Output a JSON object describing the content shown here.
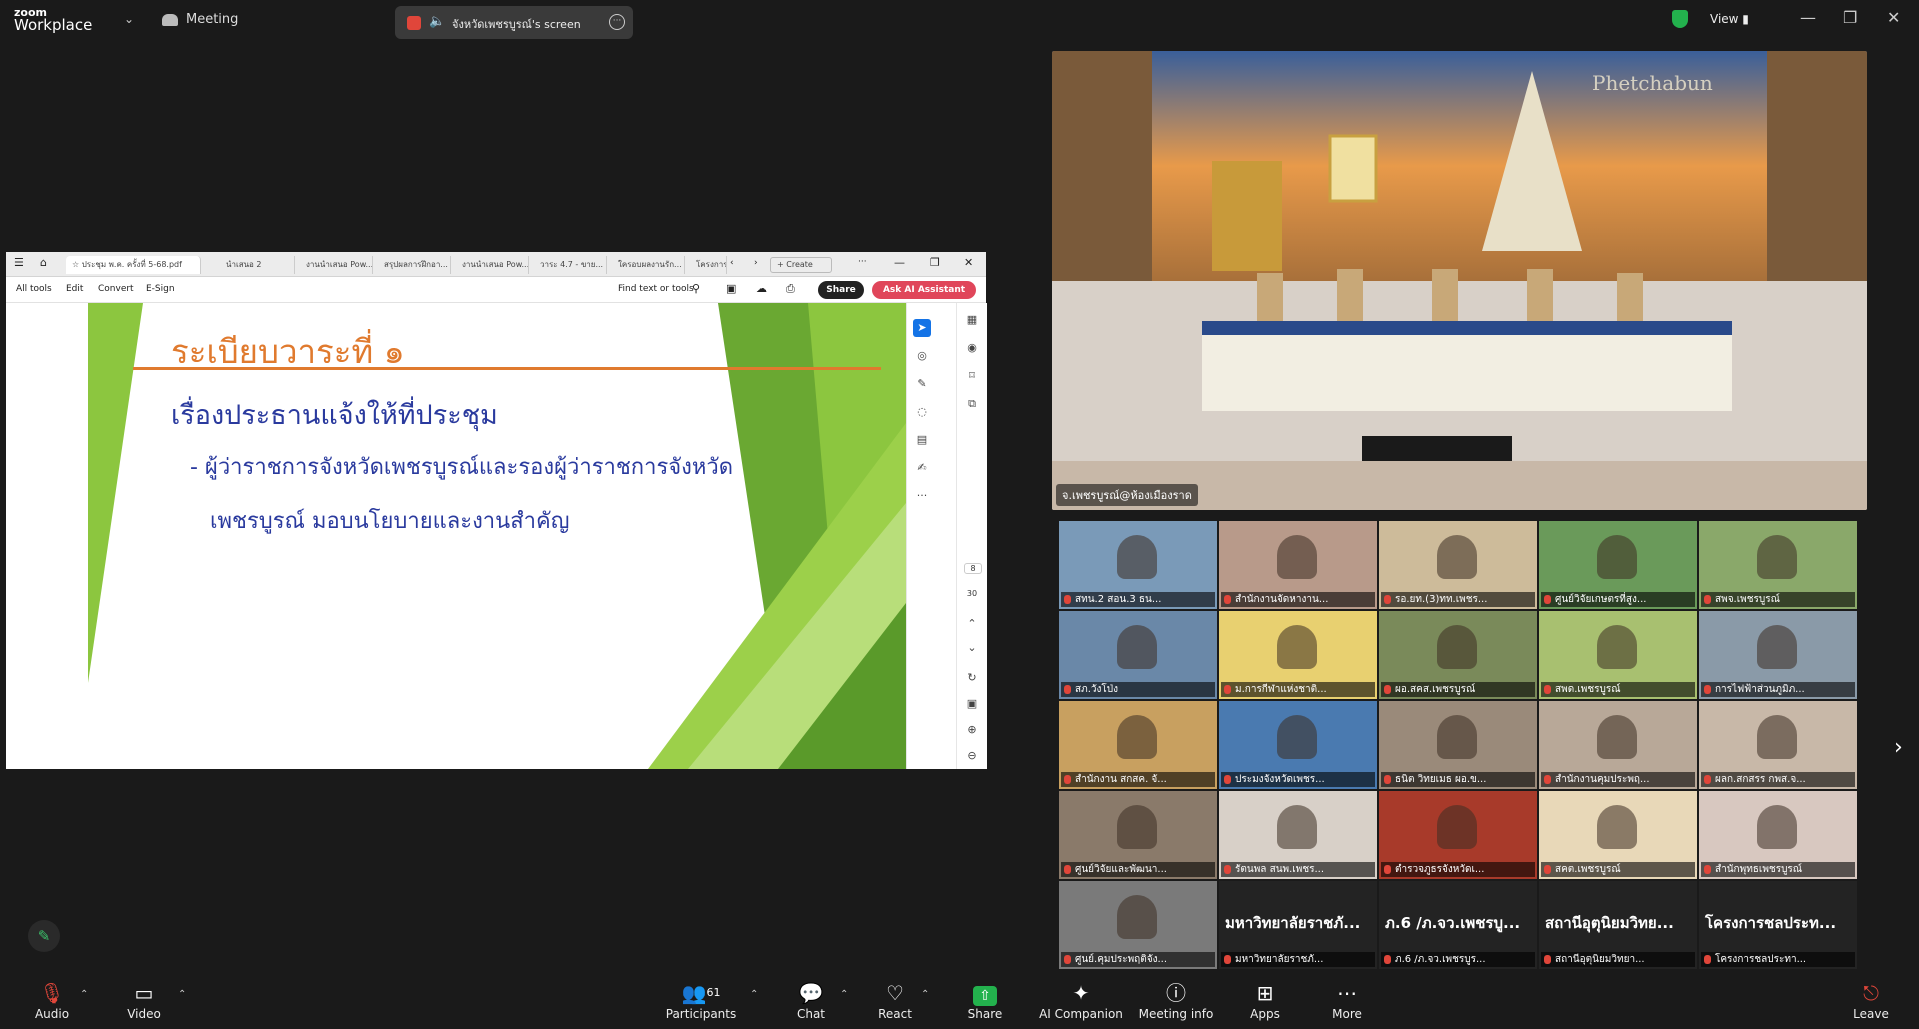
{
  "app": {
    "brand_top": "zoom",
    "brand_bottom": "Workplace",
    "meeting_label": "Meeting",
    "screen_share_label": "จังหวัดเพชรบูรณ์'s screen",
    "view_label": "View"
  },
  "pdf": {
    "tabs": [
      "ประชุม พ.ค. ครั้งที่ 5-68.pdf",
      "นำเสนอ 2",
      "งานนำเสนอ Pow...",
      "สรุปผลการฝึกอา...",
      "งานนำเสนอ Pow...",
      "วาระ 4.7 - ขาย...",
      "ใครอบผลงานรัก...",
      "โครงการ"
    ],
    "create_label": "Create",
    "menu": [
      "All tools",
      "Edit",
      "Convert",
      "E-Sign"
    ],
    "find_label": "Find text or tools",
    "share_label": "Share",
    "ai_label": "Ask AI Assistant",
    "page_current": "8",
    "page_total": "30"
  },
  "slide": {
    "title": "ระเบียบวาระที่ ๑",
    "heading": "เรื่องประธานแจ้งให้ที่ประชุม",
    "line1": "- ผู้ว่าราชการจังหวัดเพชรบูรณ์และรองผู้ว่าราชการจังหวัด",
    "line2": "เพชรบูรณ์  มอบนโยบายและงานสำคัญ"
  },
  "main_video": {
    "name": "จ.เพชรบูรณ์@ห้องเมืองราด",
    "banner": "Phetchabun"
  },
  "gallery": [
    {
      "name": "สทน.2 สอน.3 ธน...",
      "color": "#7a9ab8"
    },
    {
      "name": "สำนักงานจัดหางาน...",
      "color": "#b89a8a"
    },
    {
      "name": "รอ.ยท.(3)ทท.เพชร...",
      "color": "#cdbb9a"
    },
    {
      "name": "ศูนย์วิจัยเกษตรที่สูง...",
      "color": "#6a9a5a"
    },
    {
      "name": "สพจ.เพชรบูรณ์",
      "color": "#8aa86a"
    },
    {
      "name": "สภ.วังโป่ง",
      "color": "#6a88a8"
    },
    {
      "name": "ม.การกีฬาแห่งชาติ...",
      "color": "#e8d070"
    },
    {
      "name": "ผอ.สคส.เพชรบูรณ์",
      "color": "#7a8a5a"
    },
    {
      "name": "สพด.เพชรบูรณ์",
      "color": "#a8c070"
    },
    {
      "name": "การไฟฟ้าส่วนภูมิภ...",
      "color": "#8a9aa8"
    },
    {
      "name": "สำนักงาน สกสค. จั...",
      "color": "#c8a060"
    },
    {
      "name": "ประมงจังหวัดเพชร...",
      "color": "#4a7ab0"
    },
    {
      "name": "ธนิต วิทยเมธ ผอ.ข...",
      "color": "#9a8a7a"
    },
    {
      "name": "สำนักงานคุมประพฤ...",
      "color": "#b8a898"
    },
    {
      "name": "ผลก.สกสรร กพส.จ...",
      "color": "#c8b8a8"
    },
    {
      "name": "ศูนย์วิจัยและพัฒนา...",
      "color": "#8a7a6a"
    },
    {
      "name": "รัตนพล สนพ.เพชร...",
      "color": "#d8d0c8"
    },
    {
      "name": "ตำรวจภูธรจังหวัดเ...",
      "color": "#a83a2a"
    },
    {
      "name": "สคต.เพชรบูรณ์",
      "color": "#e8d8b8"
    },
    {
      "name": "สำนักพุทธเพชรบูรณ์",
      "color": "#d8c8c0"
    },
    {
      "name": "ศูนย์.คุมประพฤติจัง...",
      "color": "#7a7a7a"
    },
    {
      "name": "มหาวิทยาลัยราชภั...",
      "big": "มหาวิทยาลัยราชภั...",
      "color": "#232323"
    },
    {
      "name": "ภ.6 /ภ.จว.เพชรบูร...",
      "big": "ภ.6 /ภ.จว.เพชรบู...",
      "color": "#232323"
    },
    {
      "name": "สถานีอุตุนิยมวิทยา...",
      "big": "สถานีอุตุนิยมวิทย...",
      "color": "#232323"
    },
    {
      "name": "โครงการชลประทา...",
      "big": "โครงการชลประท...",
      "color": "#232323"
    }
  ],
  "bottom": {
    "audio": "Audio",
    "video": "Video",
    "participants": "Participants",
    "participants_count": "61",
    "chat": "Chat",
    "react": "React",
    "share": "Share",
    "ai": "AI Companion",
    "info": "Meeting info",
    "apps": "Apps",
    "more": "More",
    "leave": "Leave"
  }
}
